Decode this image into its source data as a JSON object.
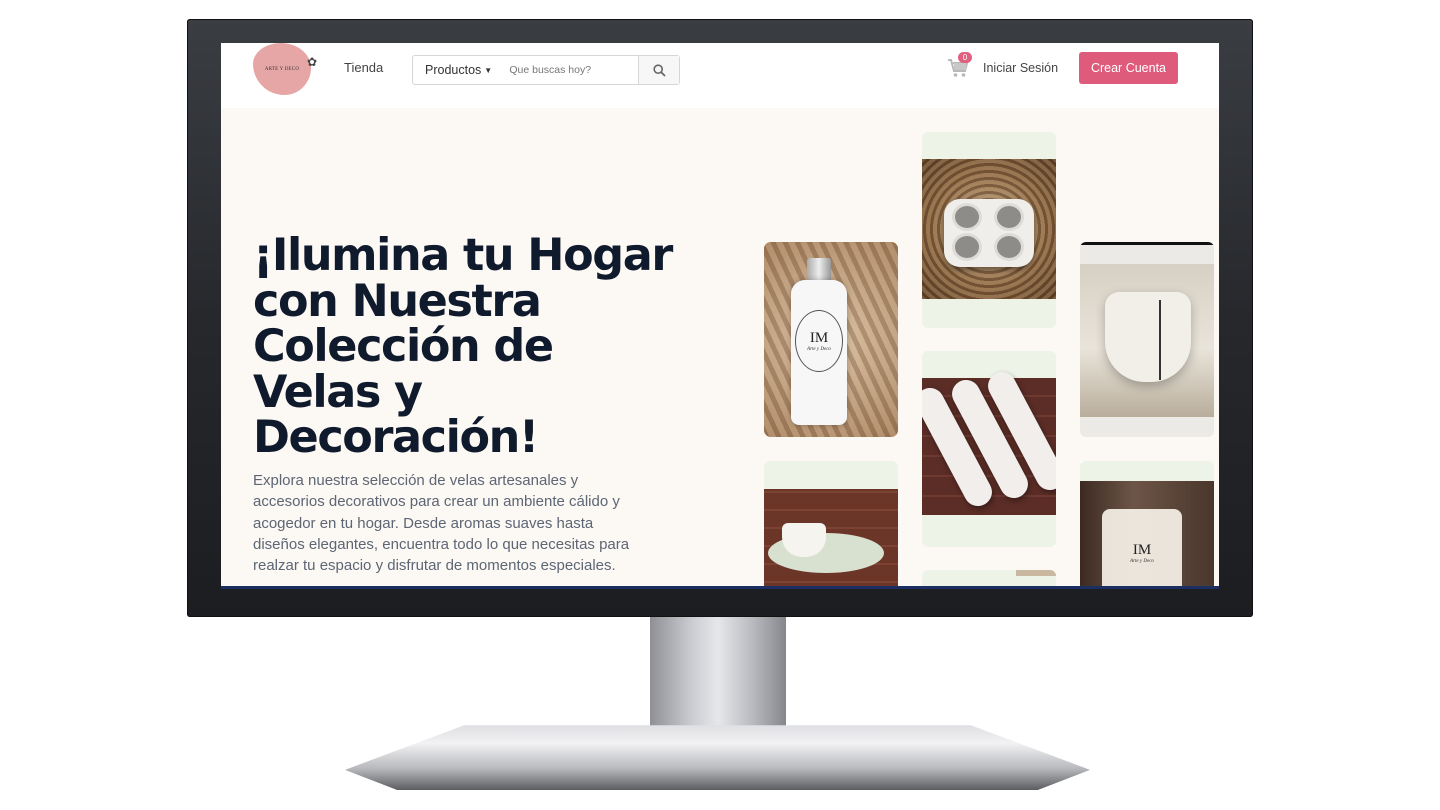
{
  "header": {
    "logo_text": "ARTE Y DECO",
    "nav_tienda": "Tienda",
    "products_dropdown": "Productos",
    "search_placeholder": "Que buscas hoy?",
    "cart_count": "0",
    "login_label": "Iniciar Sesión",
    "signup_label": "Crear Cuenta"
  },
  "hero": {
    "title": "¡Ilumina tu Hogar con Nuestra Colección de Velas y Decoración!",
    "description": "Explora nuestra selección de velas artesanales y accesorios decorativos para crear un ambiente cálido y acogedor en tu hogar. Desde aromas suaves hasta diseños elegantes, encuentra todo lo que necesitas para realzar tu espacio y disfrutar de momentos especiales."
  },
  "gallery": {
    "product_label_main": "IM",
    "product_label_sub": "Arte y Deco"
  },
  "colors": {
    "accent": "#df5b7b",
    "hero_bg": "#fcf8f4",
    "title_color": "#101a2d",
    "logo_pink": "#e6a6a6"
  },
  "icons": [
    "cart-icon",
    "search-icon",
    "chevron-down-icon",
    "sprig-icon"
  ]
}
